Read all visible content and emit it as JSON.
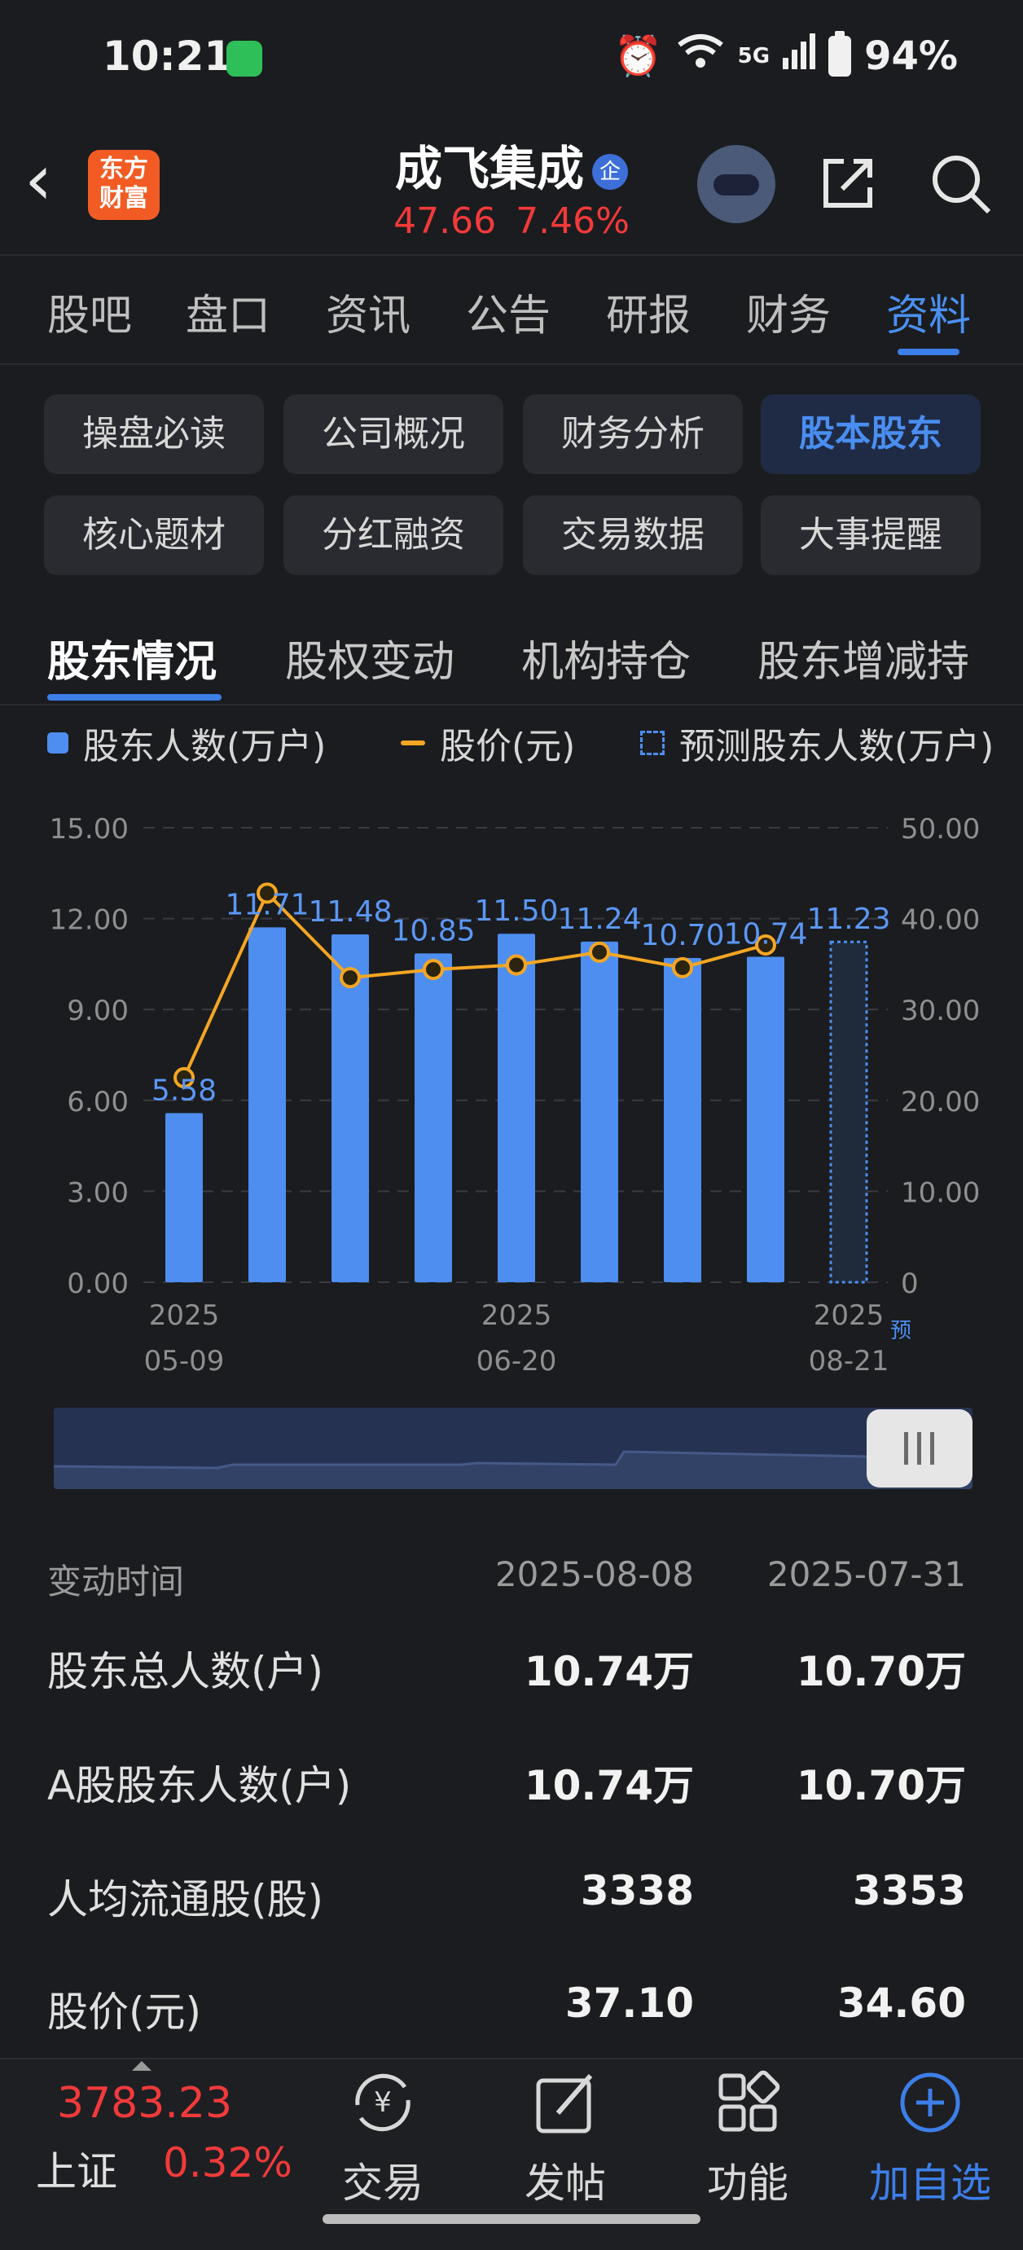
{
  "status": {
    "time": "10:21",
    "network": "5G",
    "battery": "94%"
  },
  "header": {
    "logo_line1": "东方",
    "logo_line2": "财富",
    "stock_name": "成飞集成",
    "badge": "企",
    "price": "47.66",
    "change_pct": "7.46%"
  },
  "main_tabs": [
    "股吧",
    "盘口",
    "资讯",
    "公告",
    "研报",
    "财务",
    "资料"
  ],
  "main_tab_active": "资料",
  "chips": [
    "操盘必读",
    "公司概况",
    "财务分析",
    "股本股东",
    "核心题材",
    "分红融资",
    "交易数据",
    "大事提醒"
  ],
  "chip_active": "股本股东",
  "sub_tabs": [
    "股东情况",
    "股权变动",
    "机构持仓",
    "股东增减持"
  ],
  "sub_tab_active": "股东情况",
  "legend": {
    "bar": "股东人数(万户)",
    "line": "股价(元)",
    "pred": "预测股东人数(万户)"
  },
  "chart_data": {
    "type": "bar",
    "categories": [
      "2025-05-09",
      "",
      "",
      "",
      "2025-06-20",
      "",
      "",
      "",
      "2025-08-21"
    ],
    "x_tick_labels": [
      {
        "line1": "2025",
        "line2": "05-09",
        "index": 0
      },
      {
        "line1": "2025",
        "line2": "06-20",
        "index": 4
      },
      {
        "line1": "2025",
        "line2": "08-21",
        "index": 8
      }
    ],
    "predict_mark": "预",
    "series": [
      {
        "name": "股东人数(万户)",
        "axis": "left",
        "values": [
          5.58,
          11.71,
          11.48,
          10.85,
          11.5,
          11.24,
          10.7,
          10.74,
          null
        ],
        "labels": [
          "5.58",
          "11.71",
          "11.48",
          "10.85",
          "11.50",
          "11.24",
          "10.70",
          "10.74",
          ""
        ]
      },
      {
        "name": "股价(元)",
        "axis": "right",
        "type": "line",
        "values": [
          22.5,
          42.8,
          33.5,
          34.4,
          34.9,
          36.3,
          34.6,
          37.1,
          null
        ]
      },
      {
        "name": "预测股东人数(万户)",
        "axis": "left",
        "predicted": true,
        "values": [
          null,
          null,
          null,
          null,
          null,
          null,
          null,
          null,
          11.23
        ],
        "labels": [
          "",
          "",
          "",
          "",
          "",
          "",
          "",
          "",
          "11.23"
        ]
      }
    ],
    "y_left_ticks": [
      "0.00",
      "3.00",
      "6.00",
      "9.00",
      "12.00",
      "15.00"
    ],
    "y_right_ticks": [
      "0",
      "10.00",
      "20.00",
      "30.00",
      "40.00",
      "50.00"
    ],
    "ylim_left": [
      0,
      15
    ],
    "ylim_right": [
      0,
      50
    ],
    "grid": true,
    "colors": {
      "bar": "#4d8ef0",
      "line": "#f5a623",
      "point": "#f5a623"
    }
  },
  "table": {
    "header_label": "变动时间",
    "dates": [
      "2025-08-08",
      "2025-07-31"
    ],
    "rows": [
      {
        "label": "股东总人数(户)",
        "v1": "10.74万",
        "v2": "10.70万"
      },
      {
        "label": "A股股东人数(户)",
        "v1": "10.74万",
        "v2": "10.70万"
      },
      {
        "label": "人均流通股(股)",
        "v1": "3338",
        "v2": "3353"
      },
      {
        "label": "股价(元)",
        "v1": "37.10",
        "v2": "34.60"
      }
    ]
  },
  "bottom": {
    "index_value": "3783.23",
    "index_name": "上证",
    "index_pct": "0.32%",
    "nav": [
      {
        "label": "交易",
        "icon": "yen-exchange-icon"
      },
      {
        "label": "发帖",
        "icon": "edit-post-icon"
      },
      {
        "label": "功能",
        "icon": "grid-functions-icon"
      },
      {
        "label": "加自选",
        "icon": "add-circle-icon"
      }
    ]
  }
}
